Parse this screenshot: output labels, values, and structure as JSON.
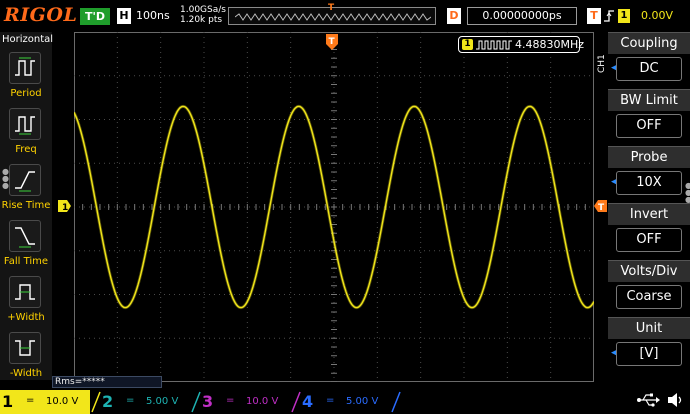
{
  "header": {
    "logo": "RIGOL",
    "run_state": "T'D",
    "horizontal_label": "H",
    "timebase": "100ns",
    "sample_rate": "1.00GSa/s",
    "memory_depth": "1.20k pts",
    "delay_label": "D",
    "delay_value": "0.00000000ps",
    "trigger_label": "T",
    "trigger_source": "1",
    "trigger_level": "0.00V"
  },
  "left_menu": {
    "title": "Horizontal",
    "items": [
      {
        "label": "Period",
        "icon": "period-icon"
      },
      {
        "label": "Freq",
        "icon": "freq-icon"
      },
      {
        "label": "Rise Time",
        "icon": "rise-time-icon"
      },
      {
        "label": "Fall Time",
        "icon": "fall-time-icon"
      },
      {
        "label": "+Width",
        "icon": "pos-width-icon"
      },
      {
        "label": "-Width",
        "icon": "neg-width-icon"
      }
    ]
  },
  "right_menu": {
    "channel": "CH1",
    "items": [
      {
        "title": "Coupling",
        "value": "DC"
      },
      {
        "title": "BW Limit",
        "value": "OFF"
      },
      {
        "title": "Probe",
        "value": "10X"
      },
      {
        "title": "Invert",
        "value": "OFF"
      },
      {
        "title": "Volts/Div",
        "value": "Coarse"
      },
      {
        "title": "Unit",
        "value": "[V]"
      }
    ]
  },
  "measurement": {
    "channel": "1",
    "frequency": "4.48830MHz",
    "rms": "Rms=*****"
  },
  "markers": {
    "ch1_offset": "1",
    "trigger_pos": "T",
    "trigger_level": "T"
  },
  "channels": [
    {
      "number": "1",
      "coupling": "=",
      "scale": "10.0 V"
    },
    {
      "number": "2",
      "coupling": "=",
      "scale": "5.00 V"
    },
    {
      "number": "3",
      "coupling": "=",
      "scale": "10.0 V"
    },
    {
      "number": "4",
      "coupling": "=",
      "scale": "5.00 V"
    }
  ],
  "colors": {
    "ch1": "#f2e61a",
    "ch2": "#1eb3b3",
    "ch3": "#c02fc6",
    "ch4": "#2a6cff",
    "trigger": "#ff7a1a",
    "logo": "#ff6a1a"
  },
  "waveform": {
    "cycles_on_screen": 4.5,
    "amplitude_divisions": 2.3,
    "start_phase_deg": 110
  }
}
